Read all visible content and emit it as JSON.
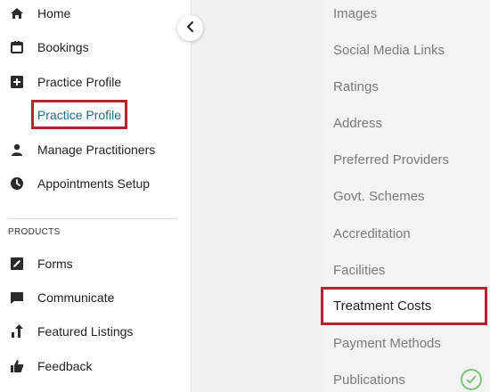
{
  "sidebar": {
    "items": [
      {
        "label": "Home",
        "icon": "home-icon"
      },
      {
        "label": "Bookings",
        "icon": "calendar-icon"
      },
      {
        "label": "Practice Profile",
        "icon": "medical-plus-icon"
      },
      {
        "label": "Manage Practitioners",
        "icon": "person-icon"
      },
      {
        "label": "Appointments Setup",
        "icon": "clock-icon"
      }
    ],
    "sub_item": "Practice Profile",
    "section_title": "PRODUCTS",
    "products": [
      {
        "label": "Forms",
        "icon": "edit-form-icon"
      },
      {
        "label": "Communicate",
        "icon": "chat-icon"
      },
      {
        "label": "Featured Listings",
        "icon": "trending-up-icon"
      },
      {
        "label": "Feedback",
        "icon": "thumbs-up-icon"
      }
    ]
  },
  "profile_menu": {
    "items": [
      "Images",
      "Social Media Links",
      "Ratings",
      "Address",
      "Preferred Providers",
      "Govt. Schemes",
      "Accreditation",
      "Facilities",
      "Treatment Costs",
      "Payment Methods",
      "Publications"
    ],
    "active": "Treatment Costs"
  },
  "colors": {
    "highlight_border": "#b0262a",
    "active_sub_text": "#1b6b8a",
    "check_green": "#7cc47c"
  }
}
